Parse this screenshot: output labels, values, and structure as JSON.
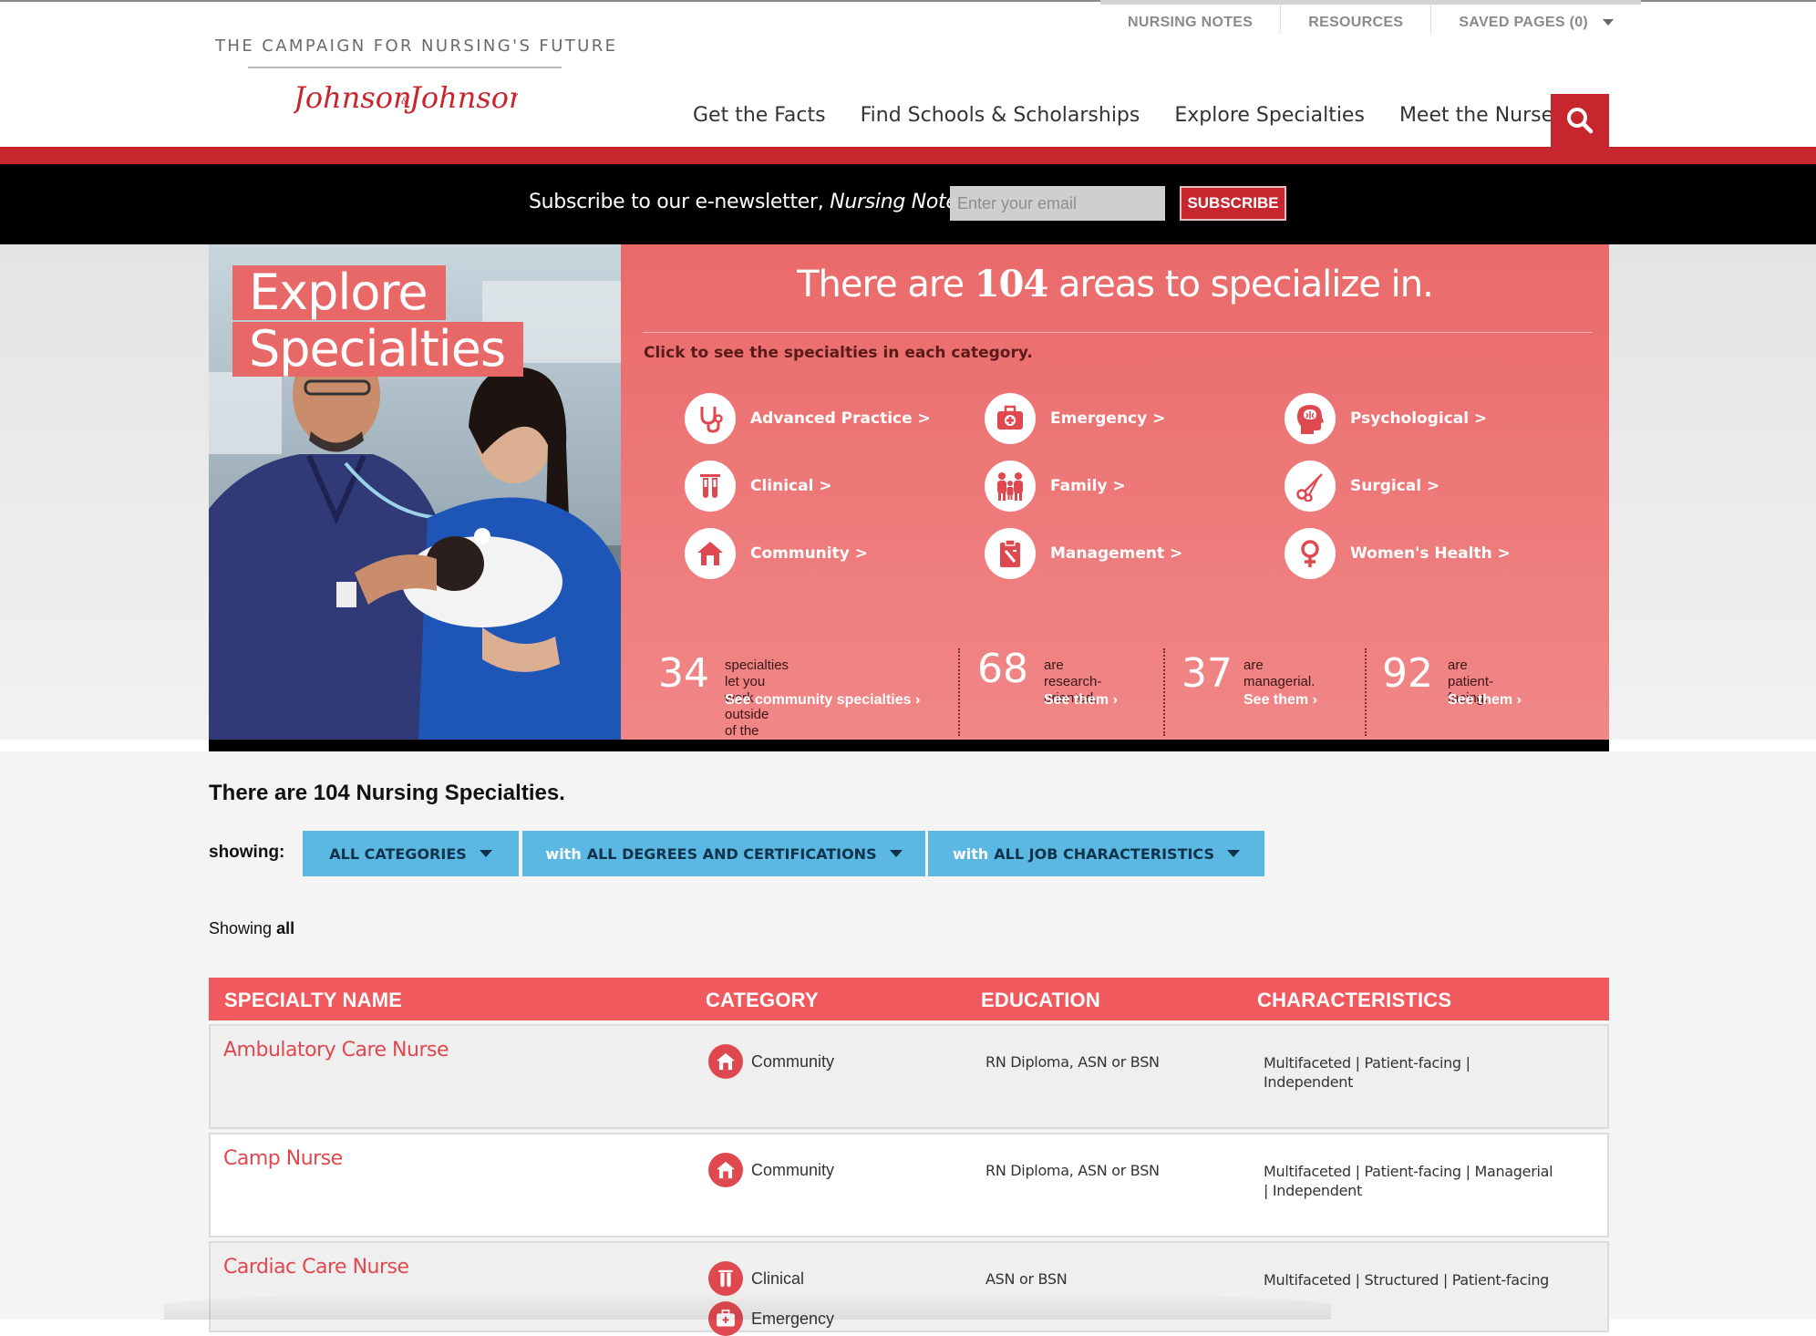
{
  "utility_nav": {
    "nursing_notes": "NURSING NOTES",
    "resources": "RESOURCES",
    "saved_pages": "SAVED PAGES (0)"
  },
  "brand": {
    "campaign": "THE CAMPAIGN FOR NURSING'S FUTURE",
    "logo_text": "Johnson & Johnson"
  },
  "main_nav": [
    "Get the Facts",
    "Find Schools & Scholarships",
    "Explore Specialties",
    "Meet the Nurses"
  ],
  "newsletter": {
    "text": "Subscribe to our e-newsletter,",
    "name": "Nursing Notes",
    "placeholder": "Enter your email",
    "button": "SUBSCRIBE"
  },
  "hero": {
    "title_line1": "Explore",
    "title_line2": "Specialties",
    "headline_pre": "There are",
    "headline_num": "104",
    "headline_post": "areas to specialize in.",
    "instruction": "Click to see the specialties in each category.",
    "categories": [
      {
        "label": "Advanced Practice >",
        "icon": "stethoscope-icon"
      },
      {
        "label": "Emergency >",
        "icon": "first-aid-kit-icon"
      },
      {
        "label": "Psychological >",
        "icon": "brain-head-icon"
      },
      {
        "label": "Clinical >",
        "icon": "test-tubes-icon"
      },
      {
        "label": "Family >",
        "icon": "family-icon"
      },
      {
        "label": "Surgical >",
        "icon": "scissors-icon"
      },
      {
        "label": "Community >",
        "icon": "house-icon"
      },
      {
        "label": "Management >",
        "icon": "clipboard-icon"
      },
      {
        "label": "Women's Health >",
        "icon": "female-symbol-icon"
      }
    ],
    "stats": [
      {
        "number": "34",
        "line1": "specialties let you work outside",
        "line2": "of the hospital.",
        "link": "See community specialties ›"
      },
      {
        "number": "68",
        "line1": "are research-",
        "line2": "oriented.",
        "link": "See them ›"
      },
      {
        "number": "37",
        "line1": "are managerial.",
        "line2": "",
        "link": "See them ›"
      },
      {
        "number": "92",
        "line1": "are patient-",
        "line2": "facing.",
        "link": "See them ›"
      }
    ]
  },
  "listing": {
    "heading": "There are 104 Nursing Specialties.",
    "showing_label": "showing:",
    "filters": [
      {
        "prefix": "",
        "label": "ALL CATEGORIES"
      },
      {
        "prefix": "with",
        "label": "ALL DEGREES AND CERTIFICATIONS"
      },
      {
        "prefix": "with",
        "label": "ALL JOB CHARACTERISTICS"
      }
    ],
    "showing_text": "Showing",
    "showing_value": "all",
    "columns": [
      "SPECIALTY NAME",
      "CATEGORY",
      "EDUCATION",
      "CHARACTERISTICS"
    ],
    "rows": [
      {
        "name": "Ambulatory Care Nurse",
        "category": "Community",
        "category2": "",
        "education": "RN Diploma, ASN or BSN",
        "char1": "Multifaceted | Patient-facing |",
        "char2": "Independent"
      },
      {
        "name": "Camp Nurse",
        "category": "Community",
        "category2": "",
        "education": "RN Diploma, ASN or BSN",
        "char1": "Multifaceted | Patient-facing | Managerial",
        "char2": "| Independent"
      },
      {
        "name": "Cardiac Care Nurse",
        "category": "Clinical",
        "category2": "Emergency",
        "education": "ASN or BSN",
        "char1": "Multifaceted | Structured | Patient-facing",
        "char2": ""
      }
    ]
  },
  "colors": {
    "brand_red": "#c8262e",
    "hero_coral": "#ec7070",
    "filter_blue": "#5ab8e3",
    "table_header": "#f05a5f"
  }
}
